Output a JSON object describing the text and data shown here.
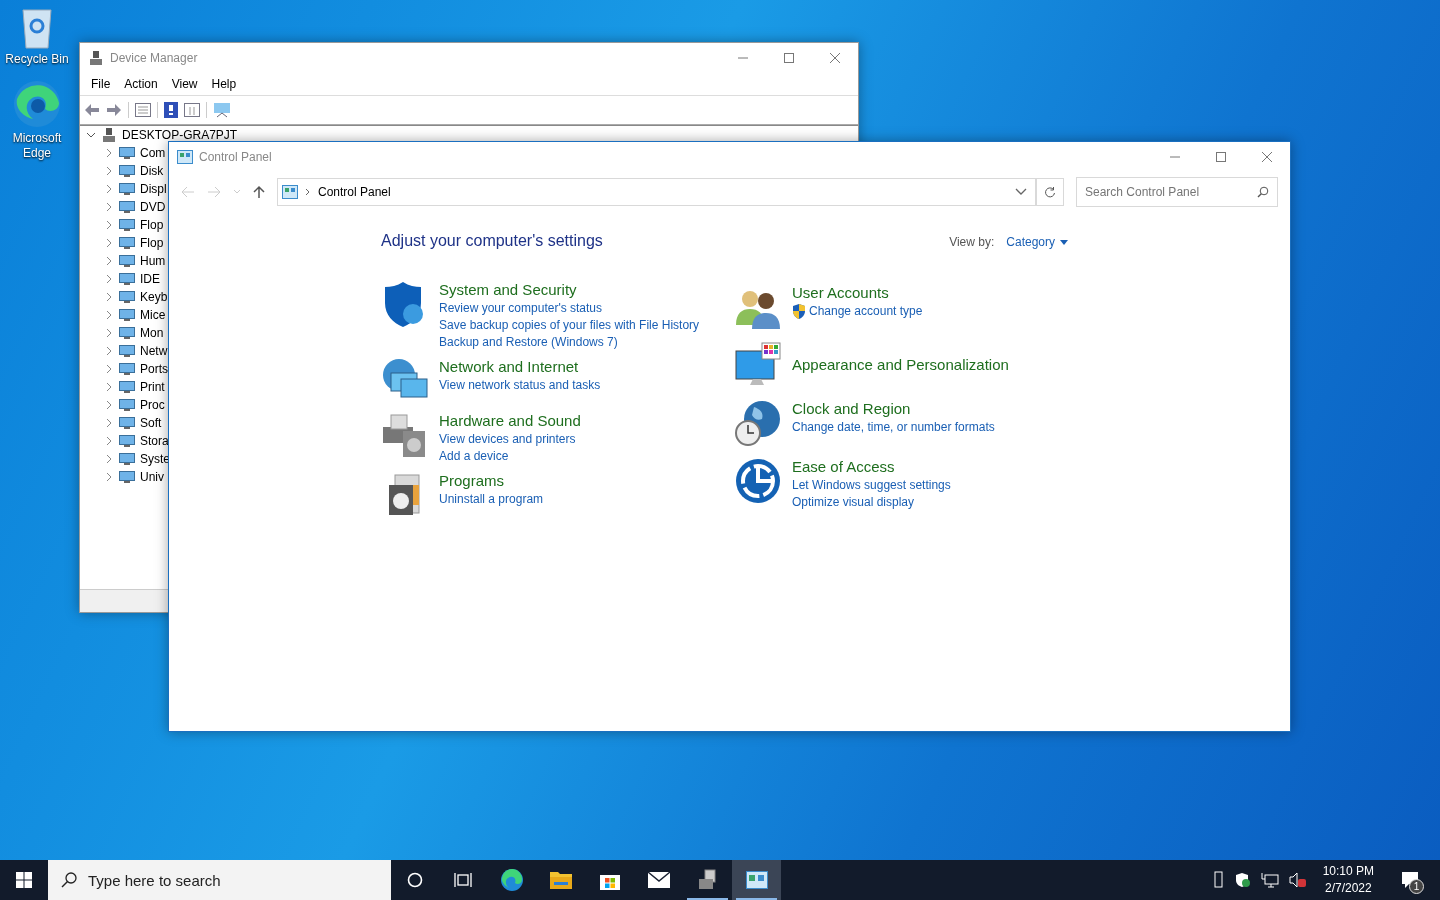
{
  "desktop_icons": [
    {
      "label": "Recycle Bin"
    },
    {
      "label": "Microsoft Edge"
    }
  ],
  "device_manager": {
    "title": "Device Manager",
    "menu": [
      "File",
      "Action",
      "View",
      "Help"
    ],
    "tree": {
      "label": "DESKTOP-GRA7PJT",
      "expanded": true,
      "children": [
        {
          "label": "Com",
          "expanded": false
        },
        {
          "label": "Disk",
          "expanded": false
        },
        {
          "label": "Displ",
          "expanded": false
        },
        {
          "label": "DVD",
          "expanded": false
        },
        {
          "label": "Flop",
          "expanded": false
        },
        {
          "label": "Flop",
          "expanded": false
        },
        {
          "label": "Hum",
          "expanded": false
        },
        {
          "label": "IDE",
          "expanded": false
        },
        {
          "label": "Keyb",
          "expanded": false
        },
        {
          "label": "Mice",
          "expanded": false
        },
        {
          "label": "Mon",
          "expanded": false
        },
        {
          "label": "Netw",
          "expanded": false
        },
        {
          "label": "Ports",
          "expanded": false
        },
        {
          "label": "Print",
          "expanded": false
        },
        {
          "label": "Proc",
          "expanded": false
        },
        {
          "label": "Soft",
          "expanded": false
        },
        {
          "label": "Stora",
          "expanded": false
        },
        {
          "label": "Syste",
          "expanded": false
        },
        {
          "label": "Univ",
          "expanded": false
        }
      ]
    }
  },
  "control_panel": {
    "title": "Control Panel",
    "breadcrumb": "Control Panel",
    "search": {
      "placeholder": "Search Control Panel"
    },
    "heading": "Adjust your computer's settings",
    "view_by_label": "View by:",
    "view_by_value": "Category",
    "left_column": [
      {
        "title": "System and Security",
        "links": [
          {
            "text": "Review your computer's status",
            "shield": false
          },
          {
            "text": "Save backup copies of your files with File History",
            "shield": false
          },
          {
            "text": "Backup and Restore (Windows 7)",
            "shield": false
          }
        ]
      },
      {
        "title": "Network and Internet",
        "links": [
          {
            "text": "View network status and tasks",
            "shield": false
          }
        ]
      },
      {
        "title": "Hardware and Sound",
        "links": [
          {
            "text": "View devices and printers",
            "shield": false
          },
          {
            "text": "Add a device",
            "shield": false
          }
        ]
      },
      {
        "title": "Programs",
        "links": [
          {
            "text": "Uninstall a program",
            "shield": false
          }
        ]
      }
    ],
    "right_column": [
      {
        "title": "User Accounts",
        "links": [
          {
            "text": "Change account type",
            "shield": true
          }
        ]
      },
      {
        "title": "Appearance and Personalization"
      },
      {
        "title": "Clock and Region",
        "links": [
          {
            "text": "Change date, time, or number formats",
            "shield": false
          }
        ]
      },
      {
        "title": "Ease of Access",
        "links": [
          {
            "text": "Let Windows suggest settings",
            "shield": false
          },
          {
            "text": "Optimize visual display",
            "shield": false
          }
        ]
      }
    ]
  },
  "taskbar": {
    "search": {
      "placeholder": "Type here to search"
    },
    "apps": [
      {
        "running": false,
        "selected": false
      },
      {
        "running": false,
        "selected": false
      },
      {
        "running": false,
        "selected": false
      },
      {
        "running": false,
        "selected": false
      },
      {
        "running": true,
        "selected": false
      },
      {
        "running": true,
        "selected": true
      }
    ],
    "time": "10:10 PM",
    "date": "2/7/2022",
    "notification_count": "1"
  }
}
